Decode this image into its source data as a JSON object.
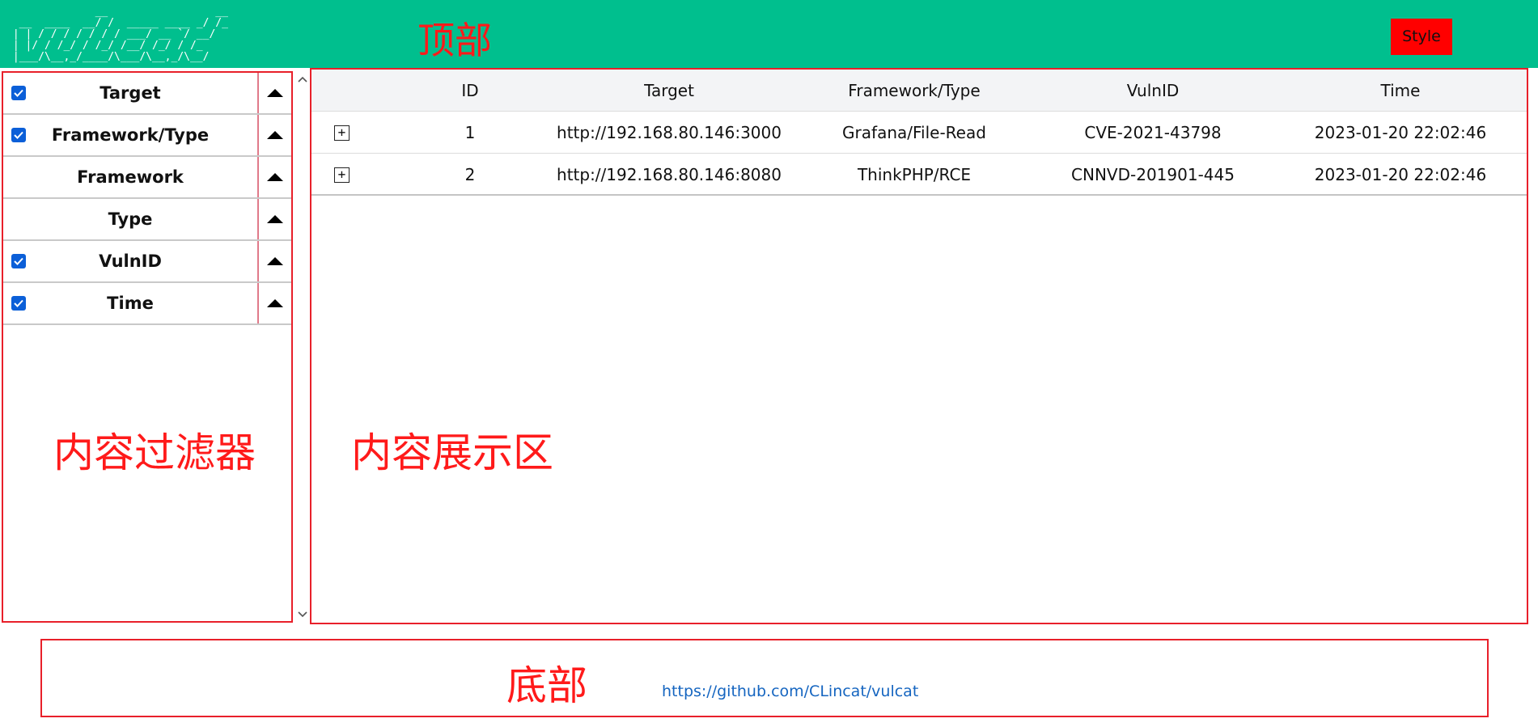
{
  "header": {
    "logo_ascii": "              __                 __  \n  __  ____  __/ /  _____ ____ _/ /_ \n | | / / / / / / / ___/ __ `/ __/ \n | |/ / /_/ / /_/ /__/ /_/ / /_   \n |___/\\__,_/____/\\___/\\__,_/\\__/  ",
    "style_label": "Style",
    "bg_color": "#00bf8e",
    "style_color": "#ff0000"
  },
  "annotations": {
    "top": "顶部",
    "filter": "内容过滤器",
    "display": "内容展示区",
    "bottom": "底部"
  },
  "filter": {
    "items": [
      {
        "label": "Target",
        "checked": true
      },
      {
        "label": "Framework/Type",
        "checked": true
      },
      {
        "label": "Framework",
        "checked": false
      },
      {
        "label": "Type",
        "checked": false
      },
      {
        "label": "VulnID",
        "checked": true
      },
      {
        "label": "Time",
        "checked": true
      }
    ]
  },
  "table": {
    "columns": [
      "ID",
      "Target",
      "Framework/Type",
      "VulnID",
      "Time"
    ],
    "rows": [
      {
        "id": "1",
        "target": "http://192.168.80.146:3000",
        "framework_type": "Grafana/File-Read",
        "vulnid": "CVE-2021-43798",
        "time": "2023-01-20 22:02:46"
      },
      {
        "id": "2",
        "target": "http://192.168.80.146:8080",
        "framework_type": "ThinkPHP/RCE",
        "vulnid": "CNNVD-201901-445",
        "time": "2023-01-20 22:02:46"
      }
    ],
    "expand_glyph": "+"
  },
  "footer": {
    "link": "https://github.com/CLincat/vulcat"
  },
  "icons": {
    "checkbox": "checkbox-checked-icon",
    "sort": "triangle-up-icon",
    "expand": "plus-box-icon",
    "scroll_up": "chevron-up-icon",
    "scroll_down": "chevron-down-icon"
  },
  "colors": {
    "accent_green": "#00bf8e",
    "annotation_red": "#ff1a1a",
    "checkbox_blue": "#0b5fd8",
    "link_blue": "#1565c0"
  }
}
